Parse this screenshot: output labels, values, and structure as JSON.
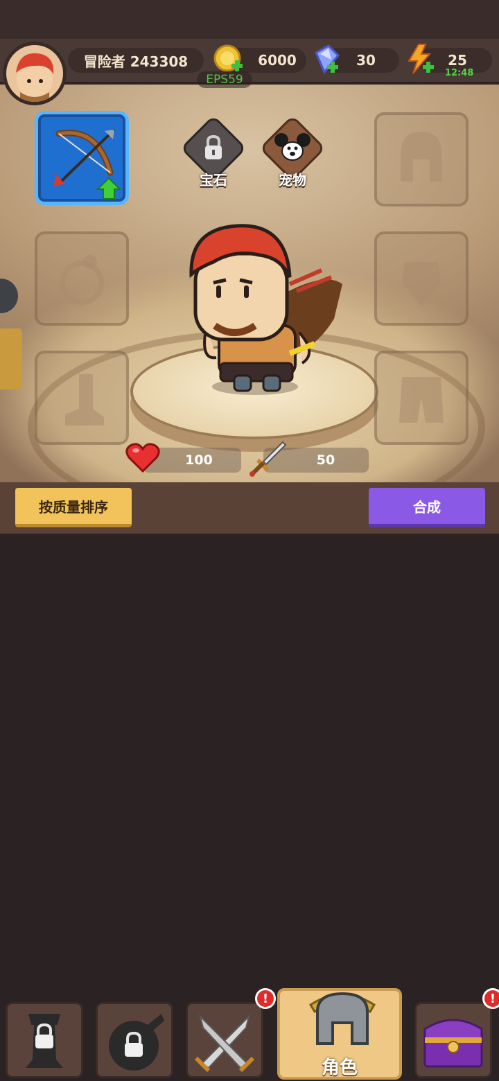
{
  "header": {
    "player_name": "冒险者 243308",
    "coins": "6000",
    "gems": "30",
    "energy": "25",
    "energy_timer": "12:48",
    "fps": "EPS59"
  },
  "tags": {
    "gem_label": "宝石",
    "pet_label": "宠物"
  },
  "stats": {
    "hp": "100",
    "attack": "50"
  },
  "actions": {
    "sort_label": "按质量排序",
    "merge_label": "合成"
  },
  "nav": {
    "active_label": "角色",
    "tabs": [
      "locked-tower",
      "locked-bomb",
      "battle",
      "character",
      "treasure"
    ]
  },
  "colors": {
    "slot_active": "#1f6fd1",
    "sort_button": "#f2c35a",
    "merge_button": "#8a5ae6",
    "alert": "#e02b2b"
  }
}
